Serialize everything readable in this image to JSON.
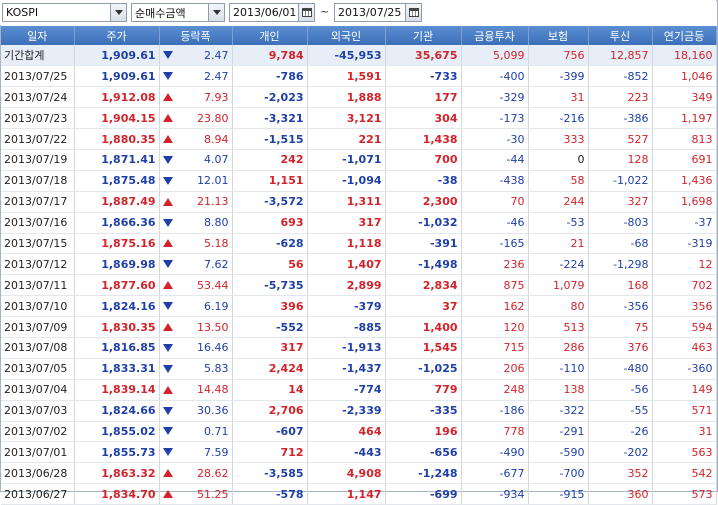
{
  "toolbar": {
    "market": "KOSPI",
    "metric": "순매수금액",
    "date_from": "2013/06/01",
    "date_sep": "~",
    "date_to": "2013/07/25"
  },
  "columns": [
    "일자",
    "주가",
    "등락폭",
    "개인",
    "외국인",
    "기관",
    "금융투자",
    "보험",
    "투신",
    "연기금등"
  ],
  "colors": {
    "up": "#d2232a",
    "down": "#1f3fa8",
    "header": "#3d6fb8"
  },
  "rows": [
    {
      "date": "기간합계",
      "price": "1,909.61",
      "dir": "down",
      "chg": "2.47",
      "ind": "9,784",
      "fgn": "-45,953",
      "inst": "35,675",
      "fin": "5,099",
      "ins": "756",
      "tru": "12,857",
      "pen": "18,160",
      "sum": true
    },
    {
      "date": "2013/07/25",
      "price": "1,909.61",
      "dir": "down",
      "chg": "2.47",
      "ind": "-786",
      "fgn": "1,591",
      "inst": "-733",
      "fin": "-400",
      "ins": "-399",
      "tru": "-852",
      "pen": "1,046"
    },
    {
      "date": "2013/07/24",
      "price": "1,912.08",
      "dir": "up",
      "chg": "7.93",
      "ind": "-2,023",
      "fgn": "1,888",
      "inst": "177",
      "fin": "-329",
      "ins": "31",
      "tru": "223",
      "pen": "349"
    },
    {
      "date": "2013/07/23",
      "price": "1,904.15",
      "dir": "up",
      "chg": "23.80",
      "ind": "-3,321",
      "fgn": "3,121",
      "inst": "304",
      "fin": "-173",
      "ins": "-216",
      "tru": "-386",
      "pen": "1,197"
    },
    {
      "date": "2013/07/22",
      "price": "1,880.35",
      "dir": "up",
      "chg": "8.94",
      "ind": "-1,515",
      "fgn": "221",
      "inst": "1,438",
      "fin": "-30",
      "ins": "333",
      "tru": "527",
      "pen": "813"
    },
    {
      "date": "2013/07/19",
      "price": "1,871.41",
      "dir": "down",
      "chg": "4.07",
      "ind": "242",
      "fgn": "-1,071",
      "inst": "700",
      "fin": "-44",
      "ins": "0",
      "tru": "128",
      "pen": "691"
    },
    {
      "date": "2013/07/18",
      "price": "1,875.48",
      "dir": "down",
      "chg": "12.01",
      "ind": "1,151",
      "fgn": "-1,094",
      "inst": "-38",
      "fin": "-438",
      "ins": "58",
      "tru": "-1,022",
      "pen": "1,436"
    },
    {
      "date": "2013/07/17",
      "price": "1,887.49",
      "dir": "up",
      "chg": "21.13",
      "ind": "-3,572",
      "fgn": "1,311",
      "inst": "2,300",
      "fin": "70",
      "ins": "244",
      "tru": "327",
      "pen": "1,698"
    },
    {
      "date": "2013/07/16",
      "price": "1,866.36",
      "dir": "down",
      "chg": "8.80",
      "ind": "693",
      "fgn": "317",
      "inst": "-1,032",
      "fin": "-46",
      "ins": "-53",
      "tru": "-803",
      "pen": "-37"
    },
    {
      "date": "2013/07/15",
      "price": "1,875.16",
      "dir": "up",
      "chg": "5.18",
      "ind": "-628",
      "fgn": "1,118",
      "inst": "-391",
      "fin": "-165",
      "ins": "21",
      "tru": "-68",
      "pen": "-319"
    },
    {
      "date": "2013/07/12",
      "price": "1,869.98",
      "dir": "down",
      "chg": "7.62",
      "ind": "56",
      "fgn": "1,407",
      "inst": "-1,498",
      "fin": "236",
      "ins": "-224",
      "tru": "-1,298",
      "pen": "12"
    },
    {
      "date": "2013/07/11",
      "price": "1,877.60",
      "dir": "up",
      "chg": "53.44",
      "ind": "-5,735",
      "fgn": "2,899",
      "inst": "2,834",
      "fin": "875",
      "ins": "1,079",
      "tru": "168",
      "pen": "702"
    },
    {
      "date": "2013/07/10",
      "price": "1,824.16",
      "dir": "down",
      "chg": "6.19",
      "ind": "396",
      "fgn": "-379",
      "inst": "37",
      "fin": "162",
      "ins": "80",
      "tru": "-356",
      "pen": "356"
    },
    {
      "date": "2013/07/09",
      "price": "1,830.35",
      "dir": "up",
      "chg": "13.50",
      "ind": "-552",
      "fgn": "-885",
      "inst": "1,400",
      "fin": "120",
      "ins": "513",
      "tru": "75",
      "pen": "594"
    },
    {
      "date": "2013/07/08",
      "price": "1,816.85",
      "dir": "down",
      "chg": "16.46",
      "ind": "317",
      "fgn": "-1,913",
      "inst": "1,545",
      "fin": "715",
      "ins": "286",
      "tru": "376",
      "pen": "463"
    },
    {
      "date": "2013/07/05",
      "price": "1,833.31",
      "dir": "down",
      "chg": "5.83",
      "ind": "2,424",
      "fgn": "-1,437",
      "inst": "-1,025",
      "fin": "206",
      "ins": "-110",
      "tru": "-480",
      "pen": "-360"
    },
    {
      "date": "2013/07/04",
      "price": "1,839.14",
      "dir": "up",
      "chg": "14.48",
      "ind": "14",
      "fgn": "-774",
      "inst": "779",
      "fin": "248",
      "ins": "138",
      "tru": "-56",
      "pen": "149"
    },
    {
      "date": "2013/07/03",
      "price": "1,824.66",
      "dir": "down",
      "chg": "30.36",
      "ind": "2,706",
      "fgn": "-2,339",
      "inst": "-335",
      "fin": "-186",
      "ins": "-322",
      "tru": "-55",
      "pen": "571"
    },
    {
      "date": "2013/07/02",
      "price": "1,855.02",
      "dir": "down",
      "chg": "0.71",
      "ind": "-607",
      "fgn": "464",
      "inst": "196",
      "fin": "778",
      "ins": "-291",
      "tru": "-26",
      "pen": "31"
    },
    {
      "date": "2013/07/01",
      "price": "1,855.73",
      "dir": "down",
      "chg": "7.59",
      "ind": "712",
      "fgn": "-443",
      "inst": "-656",
      "fin": "-490",
      "ins": "-590",
      "tru": "-202",
      "pen": "563"
    },
    {
      "date": "2013/06/28",
      "price": "1,863.32",
      "dir": "up",
      "chg": "28.62",
      "ind": "-3,585",
      "fgn": "4,908",
      "inst": "-1,248",
      "fin": "-677",
      "ins": "-700",
      "tru": "352",
      "pen": "542"
    },
    {
      "date": "2013/06/27",
      "price": "1,834.70",
      "dir": "up",
      "chg": "51.25",
      "ind": "-578",
      "fgn": "1,147",
      "inst": "-699",
      "fin": "-934",
      "ins": "-915",
      "tru": "360",
      "pen": "573"
    }
  ]
}
